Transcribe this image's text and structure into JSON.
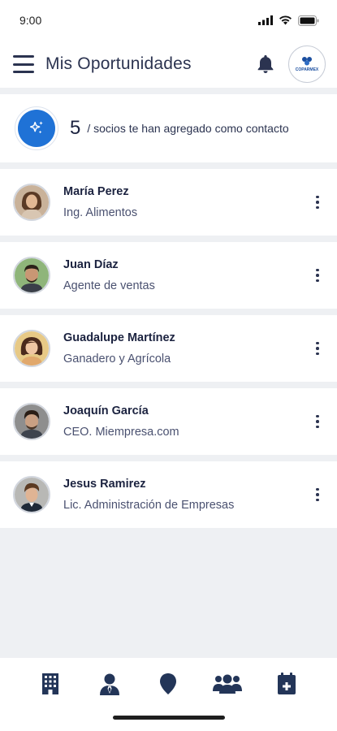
{
  "status_bar": {
    "time": "9:00"
  },
  "header": {
    "title": "Mis Oportunidades",
    "logo_text": "COPARMEX"
  },
  "banner": {
    "count": "5",
    "text": "/ socios te han agregado como contacto",
    "accent": "#1f72d6"
  },
  "contacts": [
    {
      "name": "María Perez",
      "role": "Ing. Alimentos",
      "avatar_bg": "#c9b29a",
      "hair": "#5a3a25",
      "skin": "#e2b894",
      "shirt": "#d8c6b2"
    },
    {
      "name": "Juan Díaz",
      "role": "Agente de ventas",
      "avatar_bg": "#8fb57a",
      "hair": "#2a2118",
      "skin": "#c99774",
      "shirt": "#3a3f49"
    },
    {
      "name": "Guadalupe Martínez",
      "role": "Ganadero y Agrícola",
      "avatar_bg": "#e7c986",
      "hair": "#4b2a1c",
      "skin": "#f0c6a3",
      "shirt": "#e1a86c"
    },
    {
      "name": "Joaquín García",
      "role": "CEO. Miempresa.com",
      "avatar_bg": "#8e8e8e",
      "hair": "#2a1e16",
      "skin": "#c9a083",
      "shirt": "#3d434d"
    },
    {
      "name": "Jesus Ramirez",
      "role": "Lic. Administración de Empresas",
      "avatar_bg": "#b8b8b5",
      "hair": "#5b3a22",
      "skin": "#e0b494",
      "shirt": "#1f2a38"
    }
  ],
  "bottom_nav": [
    {
      "name": "nav-building",
      "icon": "building-icon"
    },
    {
      "name": "nav-profile",
      "icon": "user-tie-icon"
    },
    {
      "name": "nav-location",
      "icon": "map-pin-icon"
    },
    {
      "name": "nav-contacts",
      "icon": "users-icon"
    },
    {
      "name": "nav-calendar",
      "icon": "calendar-plus-icon"
    }
  ],
  "colors": {
    "icon": "#233558",
    "text_dark": "#1c2340",
    "text_muted": "#4a5170"
  }
}
